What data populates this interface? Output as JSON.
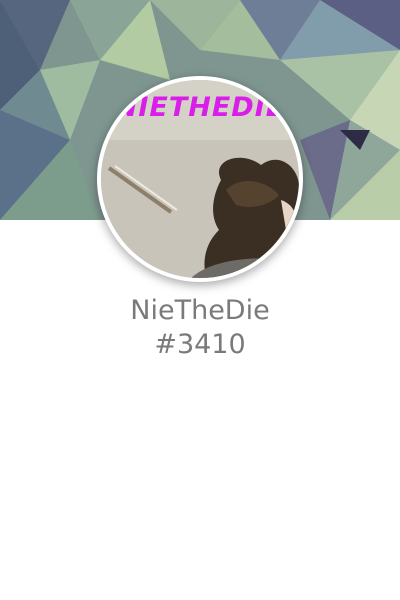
{
  "profile": {
    "username": "NieTheDie",
    "discriminator": "#3410",
    "avatar_overlay_text": "NIETHEDIE",
    "avatar_text_color": "#d81ee8"
  },
  "banner": {
    "style": "low-poly geometric",
    "colors": [
      "#5c6d82",
      "#7e9a86",
      "#a9c4a0",
      "#4f6176",
      "#8fa8a6",
      "#c8d6b2",
      "#5d5a7e"
    ]
  },
  "text_color": "#7a7a7a",
  "background_color": "#ffffff"
}
